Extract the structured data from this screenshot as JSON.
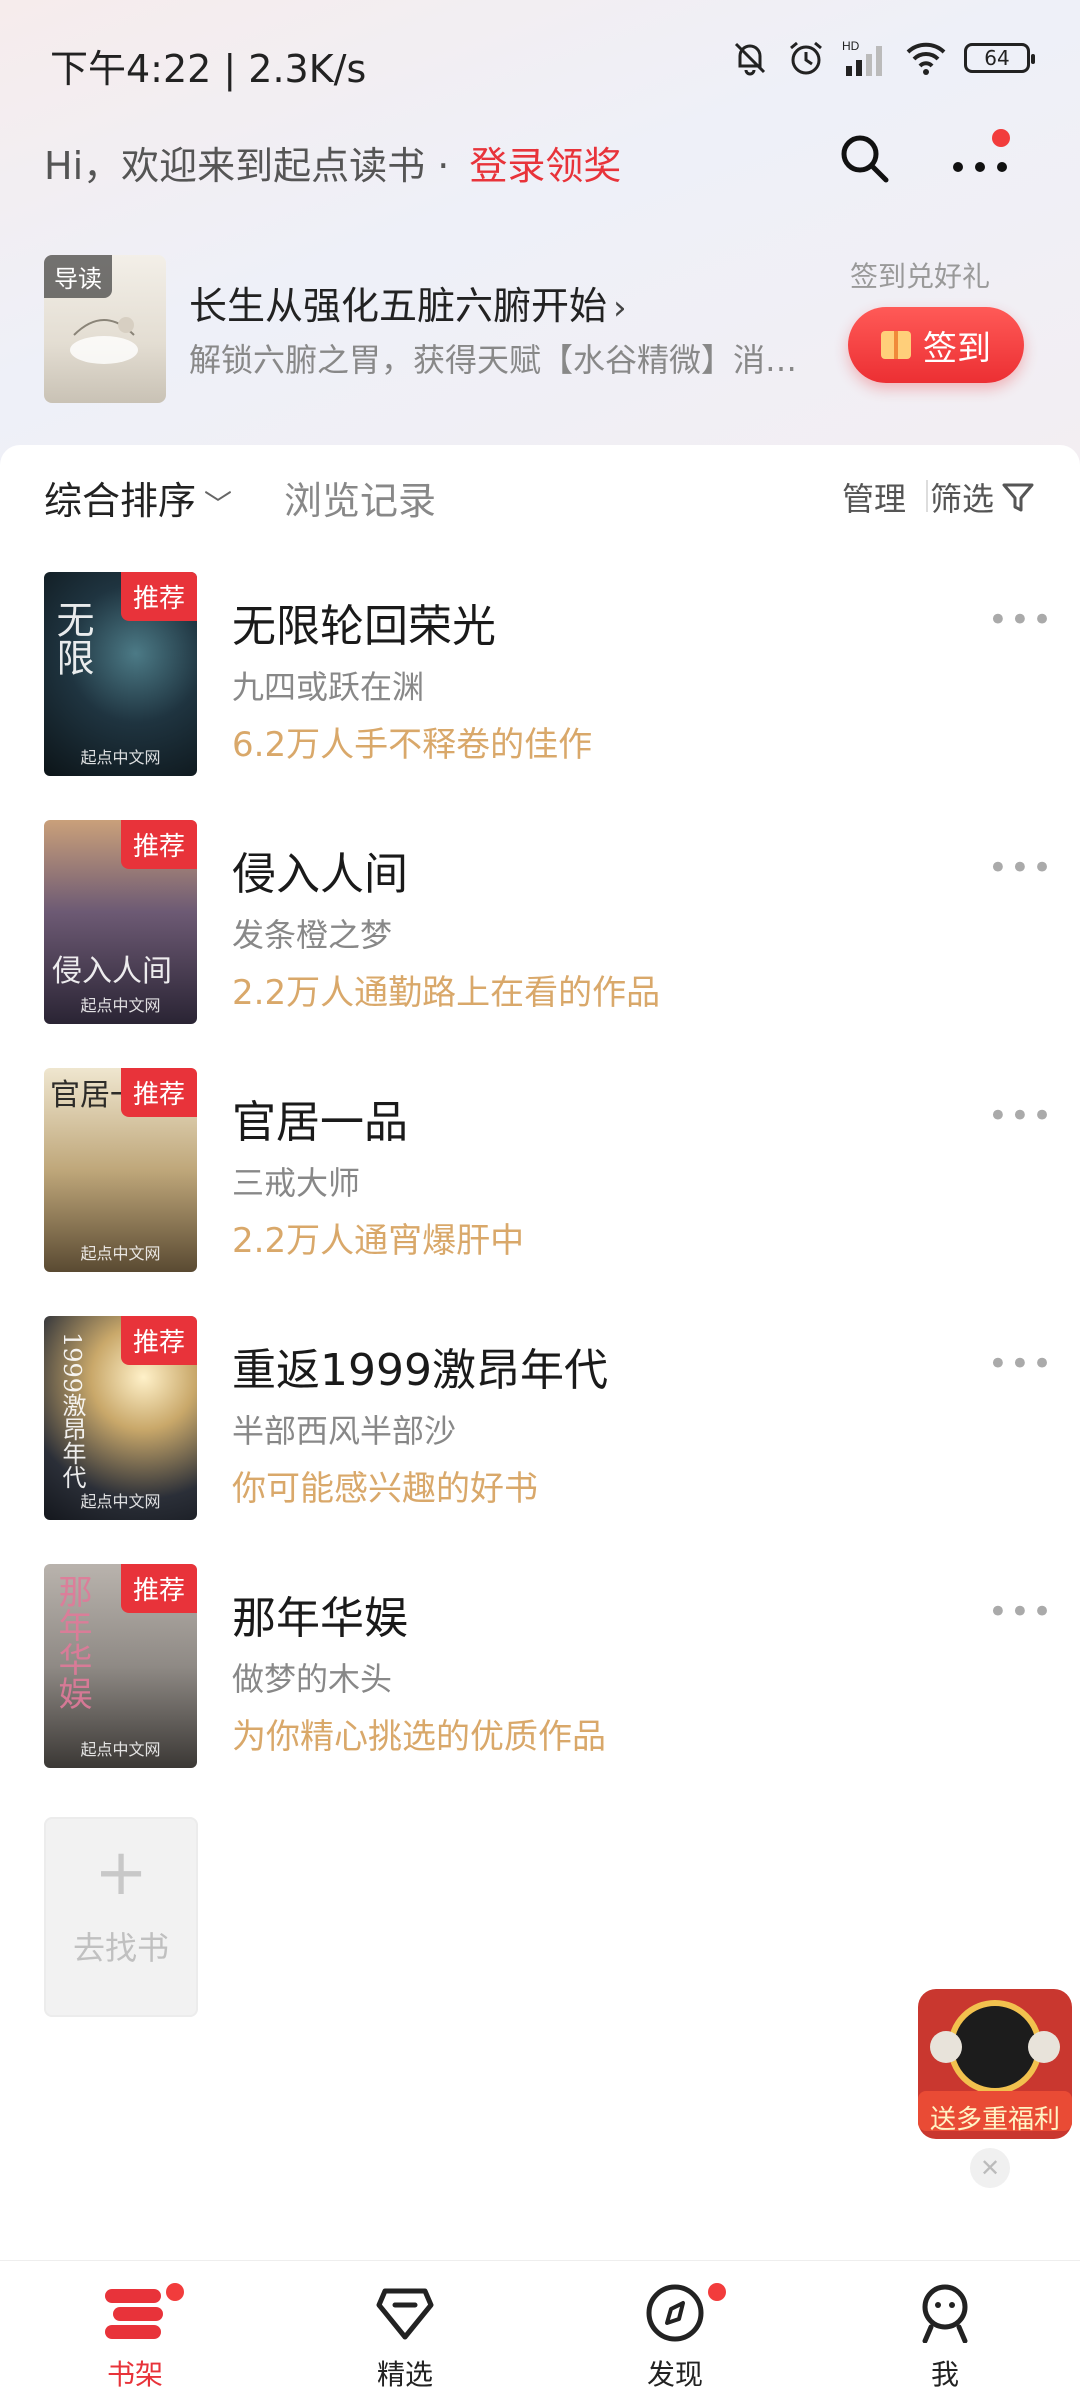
{
  "status_bar": {
    "time": "下午4:22 | 2.3K/s",
    "battery": "64"
  },
  "header": {
    "greeting": "Hi，欢迎来到起点读书 ·",
    "login_label": "登录领奖"
  },
  "recommend": {
    "cover_tag": "导读",
    "title": "长生从强化五脏六腑开始",
    "description": "解锁六腑之胃，获得天赋【水谷精微】消…",
    "signin_caption": "签到兑好礼",
    "signin_label": "签到"
  },
  "toolbar": {
    "sort_label": "综合排序",
    "history_label": "浏览记录",
    "manage_label": "管理",
    "filter_label": "筛选"
  },
  "books": [
    {
      "title": "无限轮回荣光",
      "author": "九四或跃在渊",
      "note": "6.2万人手不释卷的佳作",
      "badge": "推荐",
      "cover_text": "无限",
      "cover_brand": "起点中文网"
    },
    {
      "title": "侵入人间",
      "author": "发条橙之梦",
      "note": "2.2万人通勤路上在看的作品",
      "badge": "推荐",
      "cover_text": "侵入人间",
      "cover_brand": "起点中文网"
    },
    {
      "title": "官居一品",
      "author": "三戒大师",
      "note": "2.2万人通宵爆肝中",
      "badge": "推荐",
      "cover_text": "官居一品",
      "cover_brand": "起点中文网"
    },
    {
      "title": "重返1999激昂年代",
      "author": "半部西风半部沙",
      "note": "你可能感兴趣的好书",
      "badge": "推荐",
      "cover_text": "1999激昂年代",
      "cover_brand": "起点中文网"
    },
    {
      "title": "那年华娱",
      "author": "做梦的木头",
      "note": "为你精心挑选的优质作品",
      "badge": "推荐",
      "cover_text": "那年华娱",
      "cover_brand": "起点中文网"
    }
  ],
  "find_books": {
    "label": "去找书"
  },
  "promo": {
    "text": "送多重福利"
  },
  "tabs": [
    {
      "label": "书架",
      "icon": "bookshelf-icon",
      "active": true
    },
    {
      "label": "精选",
      "icon": "diamond-icon",
      "active": false
    },
    {
      "label": "发现",
      "icon": "compass-icon",
      "active": false
    },
    {
      "label": "我",
      "icon": "person-icon",
      "active": false
    }
  ],
  "colors": {
    "accent": "#e8333a",
    "note": "#d9a86a"
  }
}
